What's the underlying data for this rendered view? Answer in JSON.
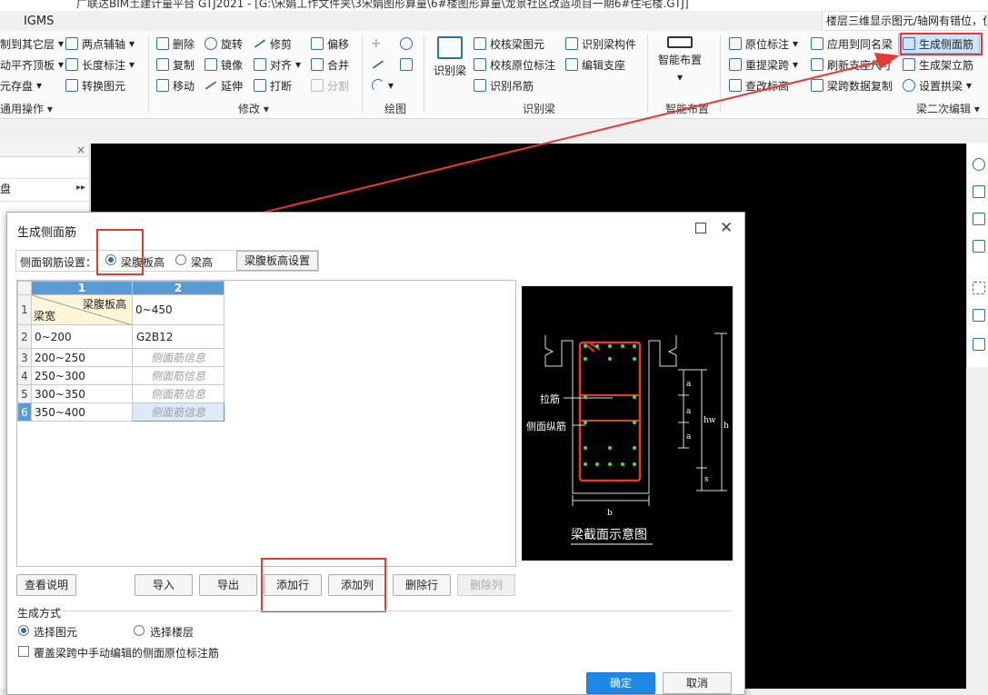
{
  "window": {
    "title": "广联达BIM土建计量平台 GTJ2021 - [G:\\宋娟工作文件夹\\3宋娟图形算量\\6#楼图形算量\\龙景社区改造项目一期6#住宅楼.GTJ]",
    "app_tab": "IGMS",
    "floor_hint": "楼层三维显示图元/轴网有错位，位"
  },
  "ribbon": {
    "common": {
      "items": [
        "制到其它层",
        "动平齐顶板",
        "元存盘"
      ],
      "group_label": "通用操作"
    },
    "aux": {
      "items": [
        "两点辅轴",
        "长度标注",
        "转换图元"
      ]
    },
    "modify": {
      "items": [
        "删除",
        "旋转",
        "修剪",
        "偏移",
        "复制",
        "镜像",
        "对齐",
        "合并",
        "移动",
        "延伸",
        "打断",
        "分割"
      ],
      "group_label": "修改"
    },
    "draw": {
      "group_label": "绘图"
    },
    "recognize": {
      "big": "识别梁",
      "items": [
        "校核梁图元",
        "识别梁构件",
        "校核原位标注",
        "编辑支座",
        "识别吊筋"
      ],
      "group_label": "识别梁"
    },
    "smart": {
      "big": "智能布置",
      "group_label": "智能布置"
    },
    "beam2": {
      "items": [
        "原位标注",
        "应用到同名梁",
        "生成侧面筋",
        "重提梁跨",
        "刷新支座尺寸",
        "生成架立筋",
        "查改标高",
        "梁跨数据复制",
        "设置拱梁"
      ],
      "group_label": "梁二次编辑"
    }
  },
  "left_panel": {
    "close": "×",
    "disk_label": "盘",
    "arrow": "▸▸"
  },
  "dialog": {
    "title": "生成侧面筋",
    "settings_label": "侧面钢筋设置：",
    "option_web_height": "梁腹板高",
    "option_beam_height": "梁高",
    "settings_button": "梁腹板高设置",
    "grid": {
      "col_numbers": [
        "1",
        "2"
      ],
      "corner_top": "梁腹板高",
      "corner_bottom": "梁宽",
      "header_value": "0~450",
      "rows": [
        {
          "num": "1",
          "width": "",
          "value": ""
        },
        {
          "num": "2",
          "width": "0~200",
          "value": "G2B12",
          "placeholder": false
        },
        {
          "num": "3",
          "width": "200~250",
          "value": "侧面筋信息",
          "placeholder": true
        },
        {
          "num": "4",
          "width": "250~300",
          "value": "侧面筋信息",
          "placeholder": true
        },
        {
          "num": "5",
          "width": "300~350",
          "value": "侧面筋信息",
          "placeholder": true
        },
        {
          "num": "6",
          "width": "350~400",
          "value": "侧面筋信息",
          "placeholder": true
        }
      ]
    },
    "diagram": {
      "caption": "梁截面示意图",
      "label_tie": "拉筋",
      "label_side": "侧面纵筋",
      "dim_a": "a",
      "dim_hw": "hw",
      "dim_h": "h",
      "dim_s": "s",
      "dim_b": "b"
    },
    "buttons": {
      "help": "查看说明",
      "import": "导入",
      "export": "导出",
      "add_row": "添加行",
      "add_col": "添加列",
      "del_row": "删除行",
      "del_col": "删除列",
      "ok": "确定",
      "cancel": "取消"
    },
    "generate": {
      "label": "生成方式",
      "option_elements": "选择图元",
      "option_floors": "选择楼层",
      "overwrite_label": "覆盖梁跨中手动编辑的侧面原位标注筋"
    }
  }
}
